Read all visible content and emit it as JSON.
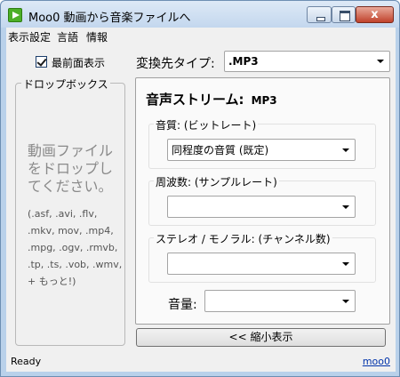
{
  "window": {
    "title": "Moo0 動画から音楽ファイルへ",
    "close_glyph": "x"
  },
  "menu": {
    "items": [
      {
        "label": "表示設定"
      },
      {
        "label": "言語"
      },
      {
        "label": "情報"
      }
    ]
  },
  "always_on_top": {
    "label": "最前面表示",
    "checked": true
  },
  "dropbox": {
    "title": "ドロップボックス",
    "message": "動画ファイルをドロップしてください。",
    "extensions": "(.asf, .avi, .flv, .mkv, mov, .mp4, .mpg, .ogv, .rmvb, .tp, .ts, .vob, .wmv, + もっと!)"
  },
  "output_type": {
    "label": "変換先タイプ:",
    "value": ".MP3"
  },
  "stream": {
    "title": "音声ストリーム:",
    "format": "MP3",
    "quality": {
      "label": "音質: (ビットレート)",
      "value": "同程度の音質 (既定)"
    },
    "frequency": {
      "label": "周波数: (サンプルレート)",
      "value": ""
    },
    "channels": {
      "label": "ステレオ / モノラル: (チャンネル数)",
      "value": ""
    },
    "volume": {
      "label": "音量:",
      "value": ""
    }
  },
  "shrink_button": {
    "label": "<< 縮小表示"
  },
  "status": {
    "text": "Ready",
    "link": "moo0"
  }
}
